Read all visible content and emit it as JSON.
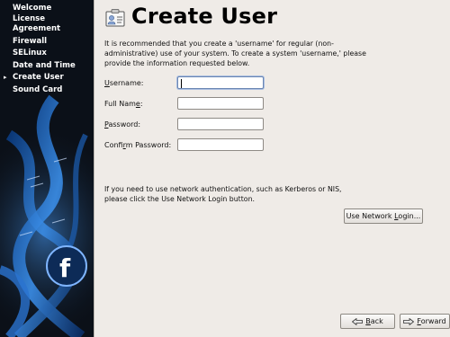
{
  "sidebar": {
    "items": [
      {
        "label": "Welcome",
        "current": false
      },
      {
        "label": "License Agreement",
        "current": false
      },
      {
        "label": "Firewall",
        "current": false
      },
      {
        "label": "SELinux",
        "current": false
      },
      {
        "label": "Date and Time",
        "current": false
      },
      {
        "label": "Create User",
        "current": true
      },
      {
        "label": "Sound Card",
        "current": false
      }
    ],
    "current_marker": "▸"
  },
  "header": {
    "title": "Create User",
    "icon": "user-card-icon"
  },
  "intro_text": "It is recommended that you create a 'username' for regular (non-administrative) use of your system. To create a system 'username,' please provide the information requested below.",
  "form": {
    "username": {
      "label_pre": "",
      "label_mnemonic": "U",
      "label_post": "sername:",
      "value": ""
    },
    "full_name": {
      "label_pre": "Full Nam",
      "label_mnemonic": "e",
      "label_post": ":",
      "value": ""
    },
    "password": {
      "label_pre": "",
      "label_mnemonic": "P",
      "label_post": "assword:",
      "value": ""
    },
    "confirm_password": {
      "label_pre": "Confi",
      "label_mnemonic": "r",
      "label_post": "m Password:",
      "value": ""
    }
  },
  "network": {
    "text": "If you need to use network authentication, such as Kerberos or NIS, please click the Use Network Login button.",
    "button_pre": "Use Network ",
    "button_mnemonic": "L",
    "button_post": "ogin..."
  },
  "footer": {
    "back_mnemonic": "B",
    "back_post": "ack",
    "forward_mnemonic": "F",
    "forward_post": "orward"
  },
  "colors": {
    "sidebar_bg": "#0b1018",
    "main_bg": "#efebe7",
    "art_blue": "#2f7fd6"
  }
}
